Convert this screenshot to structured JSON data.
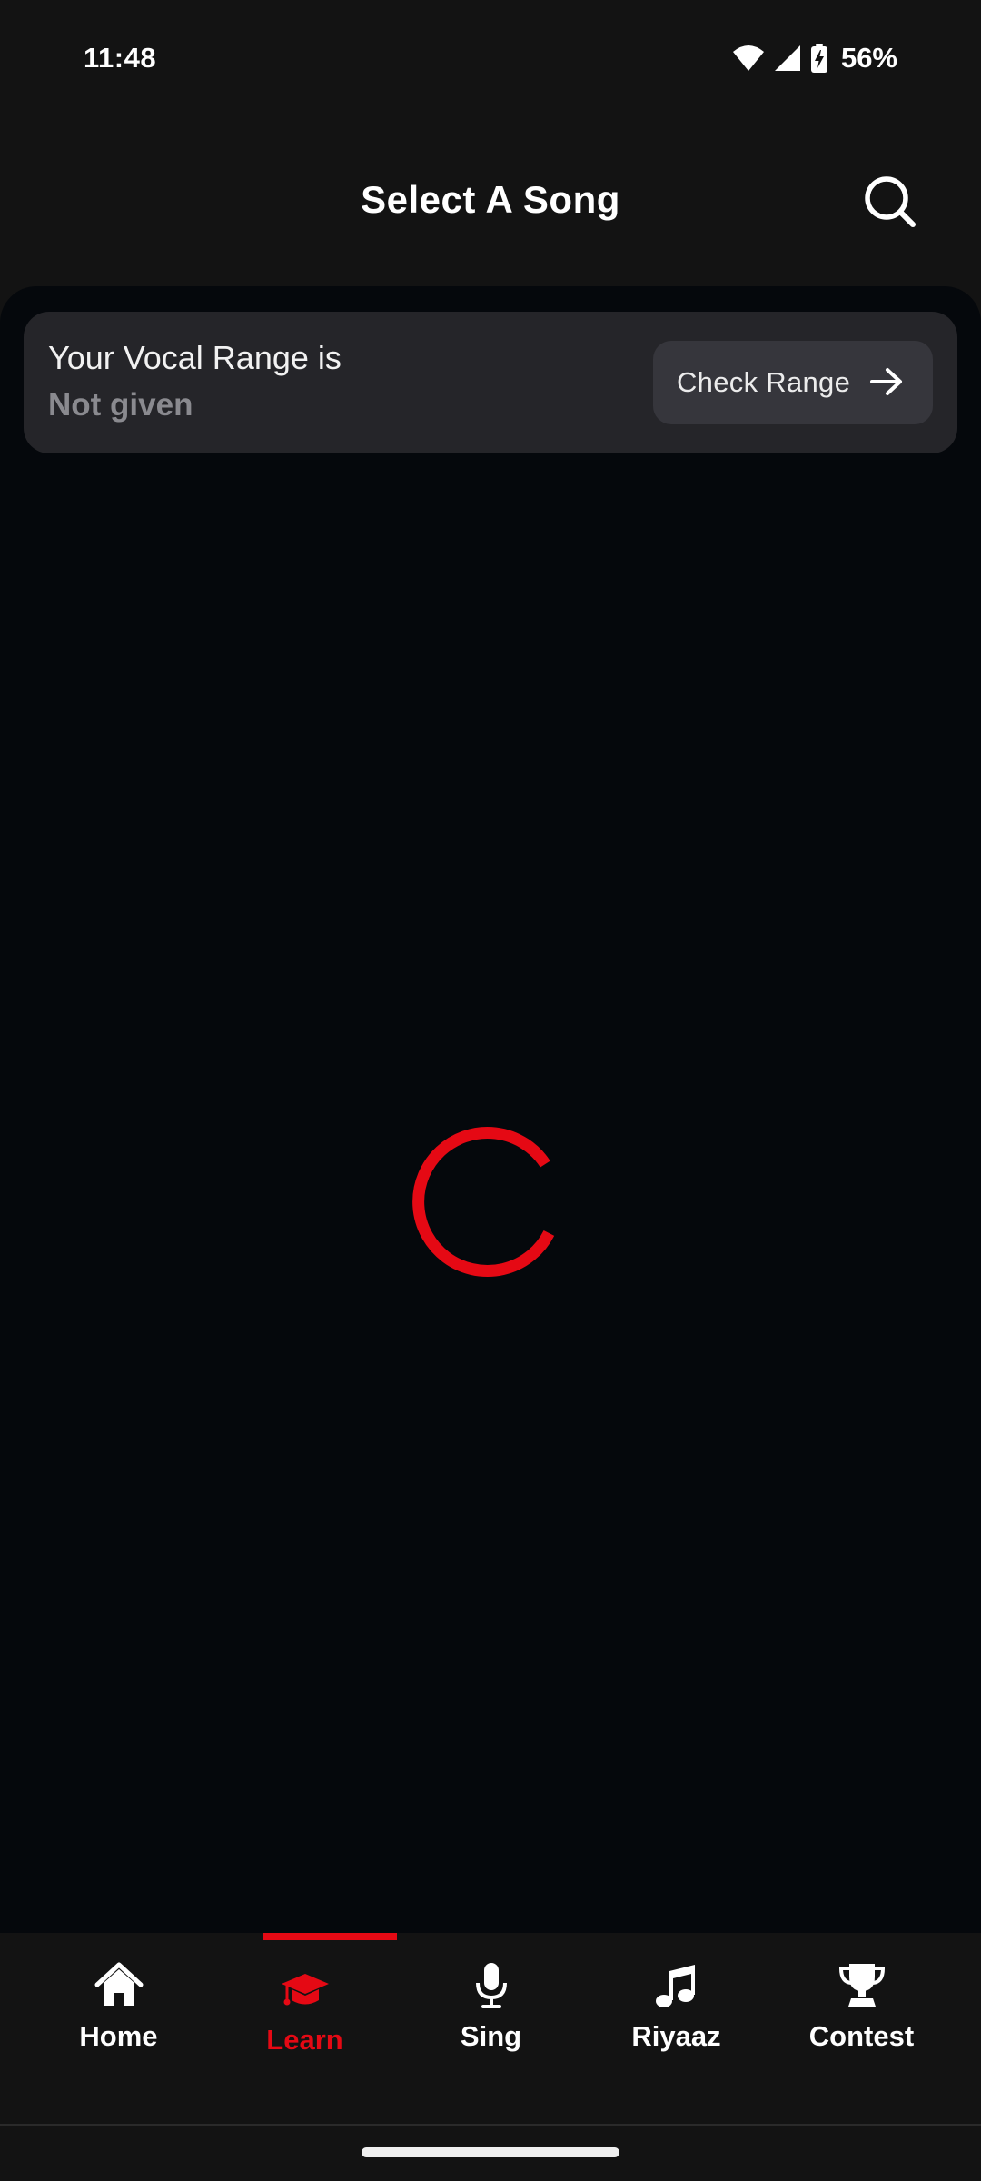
{
  "status_bar": {
    "time": "11:48",
    "battery": "56%",
    "icons": [
      "wifi-icon",
      "cell-signal-icon",
      "battery-charging-icon"
    ]
  },
  "header": {
    "title": "Select A Song",
    "search_icon": "search-icon"
  },
  "vocal_range": {
    "label": "Your Vocal Range is",
    "value": "Not given",
    "button_label": "Check Range",
    "button_icon": "arrow-right-icon"
  },
  "loading": {
    "icon": "loading-spinner"
  },
  "bottom_nav": {
    "active_index": 1,
    "items": [
      {
        "label": "Home",
        "icon": "home-icon"
      },
      {
        "label": "Learn",
        "icon": "graduation-cap-icon"
      },
      {
        "label": "Sing",
        "icon": "microphone-icon"
      },
      {
        "label": "Riyaaz",
        "icon": "music-note-icon"
      },
      {
        "label": "Contest",
        "icon": "trophy-icon"
      }
    ]
  },
  "colors": {
    "accent": "#e50914",
    "background": "#131313",
    "panel": "#05080c",
    "card": "#252529",
    "button": "#36363c",
    "muted_text": "#8a8a8f"
  }
}
